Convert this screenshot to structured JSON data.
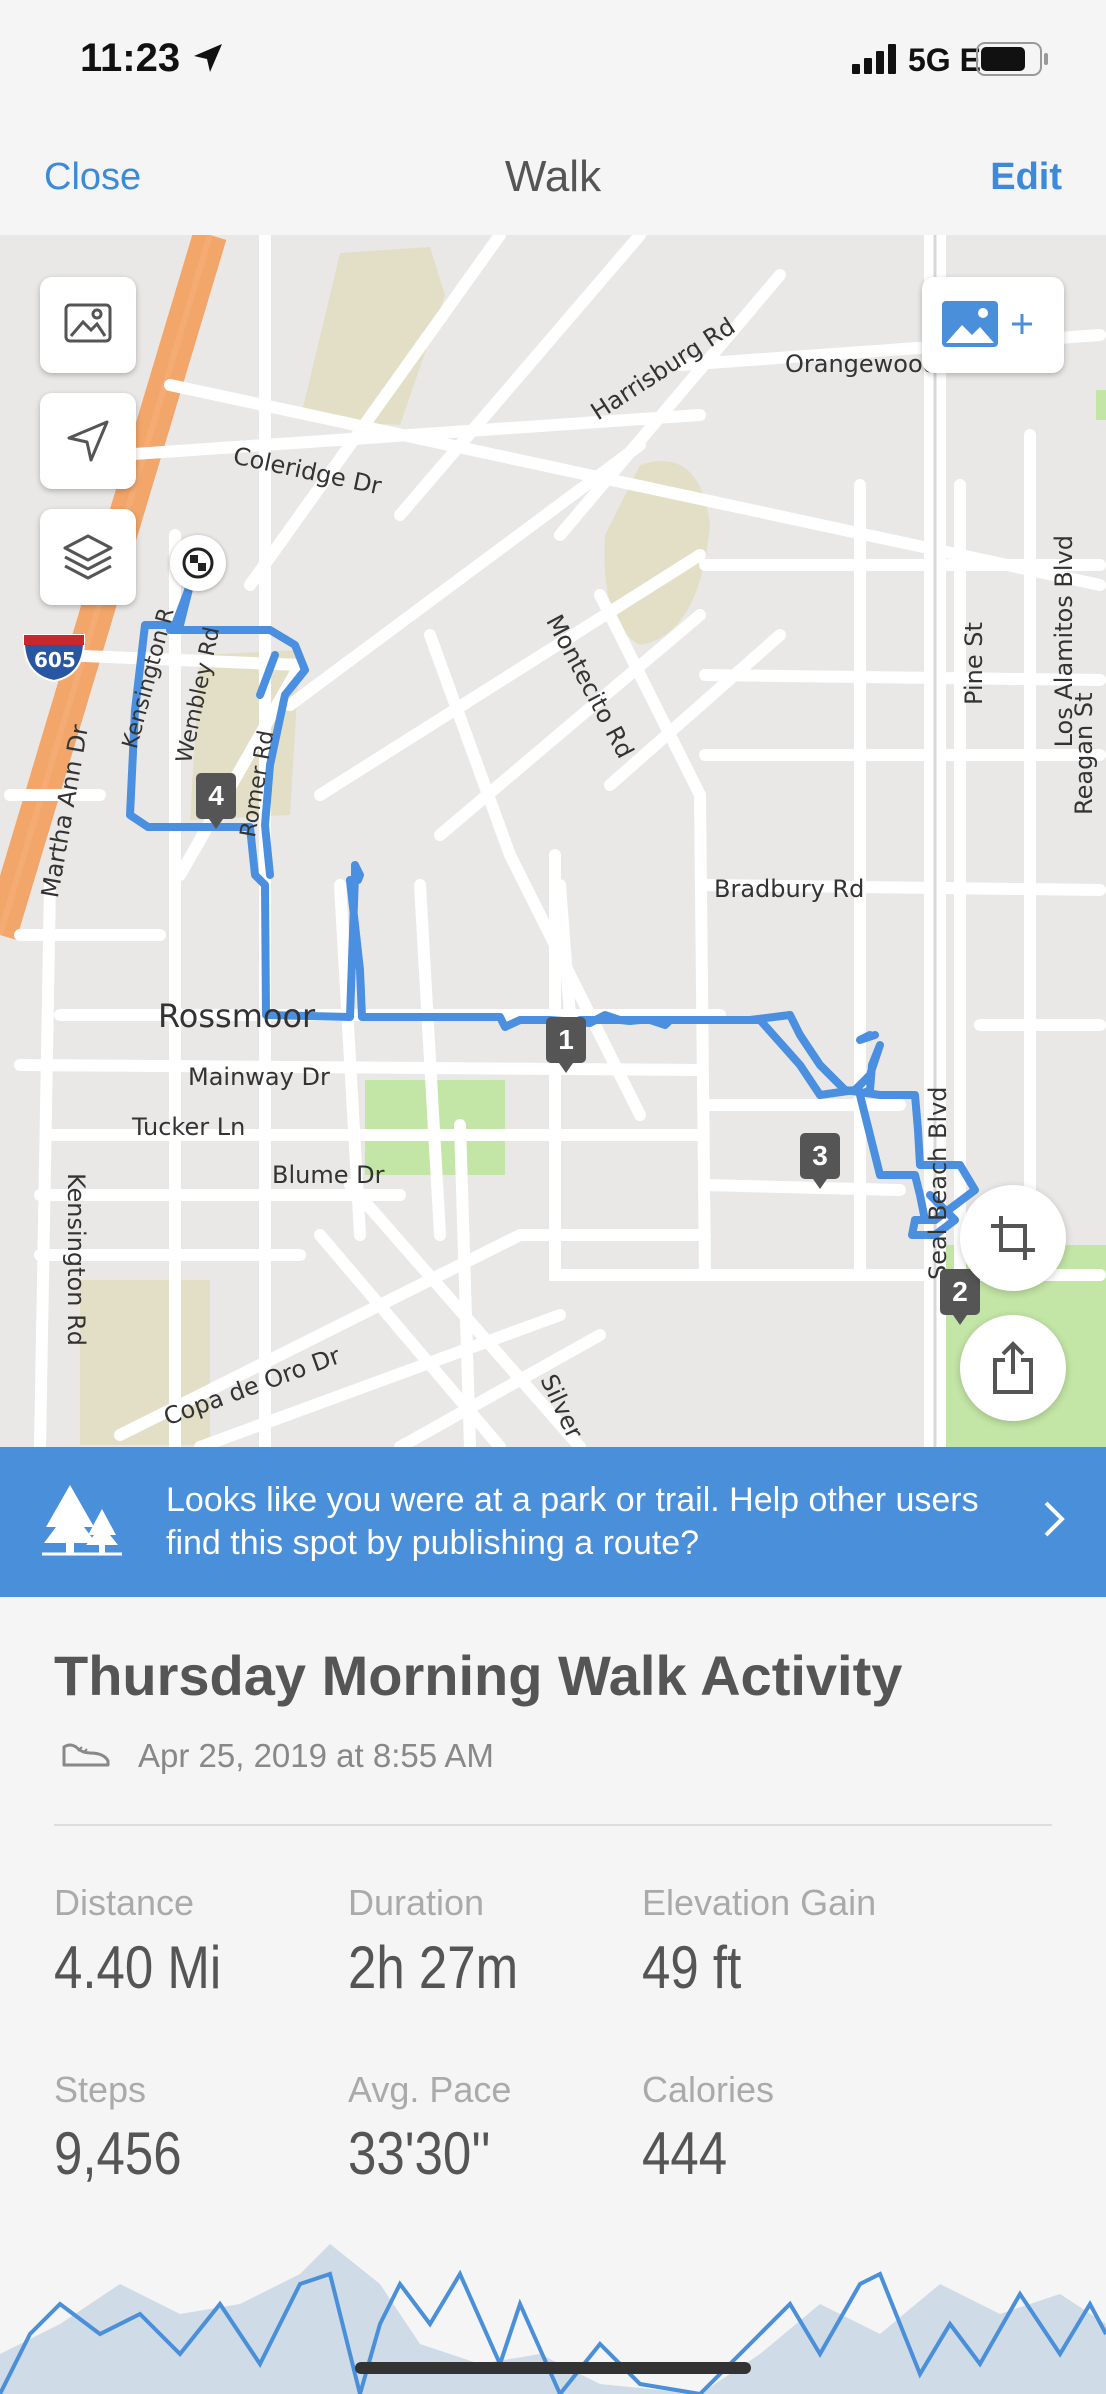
{
  "status": {
    "time": "11:23",
    "network": "5G E"
  },
  "nav": {
    "close": "Close",
    "title": "Walk",
    "edit": "Edit"
  },
  "map": {
    "labels": {
      "harrisburg": "Harrisburg Rd",
      "orangewood": "Orangewood",
      "coleridge": "Coleridge Dr",
      "los_alamitos": "Los Alamitos Blvd",
      "pine": "Pine St",
      "reagan": "Reagan St",
      "montecito": "Montecito Rd",
      "kensington_top": "Kensington R",
      "wembley": "Wembley Rd",
      "martha_ann": "Martha Ann Dr",
      "bradbury": "Bradbury Rd",
      "rossmoor": "Rossmoor",
      "mainway": "Mainway Dr",
      "tucker": "Tucker Ln",
      "blume": "Blume Dr",
      "kensington_bottom": "Kensington Rd",
      "seal_beach": "Seal Beach Blvd",
      "oro": "Copa de Oro Dr",
      "silver": "Silver",
      "interstate": "605",
      "romer": "Romer Rd"
    },
    "markers": [
      "1",
      "2",
      "3",
      "4"
    ],
    "route_color": "#4a8fe0"
  },
  "banner": {
    "text": "Looks like you were at a park or trail. Help other users find this spot by publishing a route?"
  },
  "activity": {
    "title": "Thursday Morning Walk Activity",
    "date": "Apr 25, 2019 at 8:55 AM",
    "stats": [
      {
        "label": "Distance",
        "value": "4.40 Mi"
      },
      {
        "label": "Duration",
        "value": "2h 27m"
      },
      {
        "label": "Elevation Gain",
        "value": "49 ft"
      },
      {
        "label": "Steps",
        "value": "9,456"
      },
      {
        "label": "Avg. Pace",
        "value": "33'30''"
      },
      {
        "label": "Calories",
        "value": "444"
      }
    ]
  }
}
